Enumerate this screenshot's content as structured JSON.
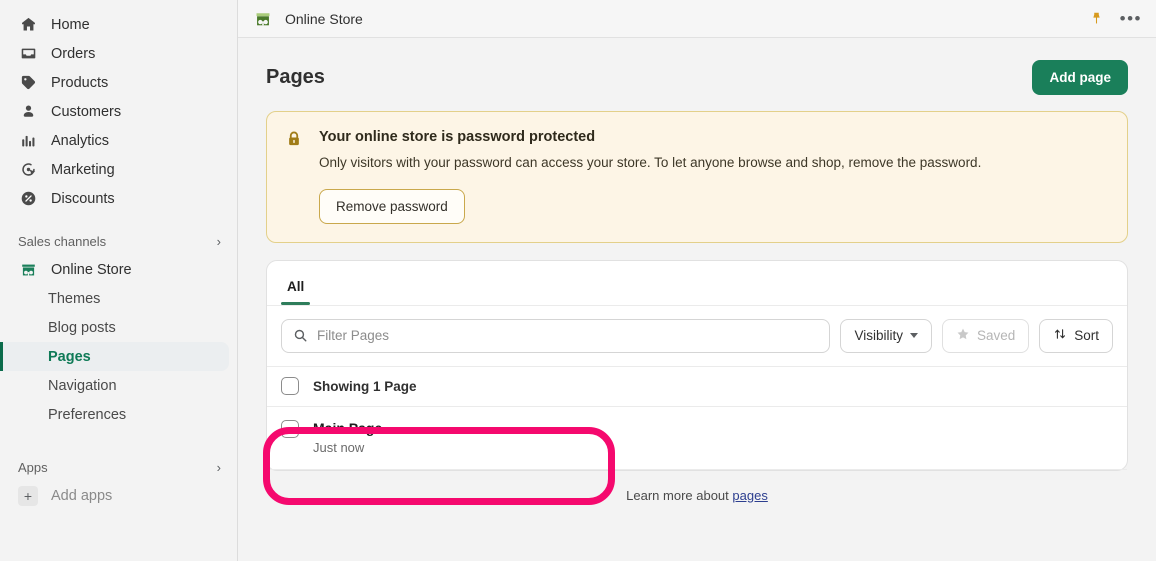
{
  "sidebar": {
    "primary_items": [
      {
        "label": "Home",
        "icon": "home-icon"
      },
      {
        "label": "Orders",
        "icon": "orders-icon"
      },
      {
        "label": "Products",
        "icon": "products-tag-icon"
      },
      {
        "label": "Customers",
        "icon": "customers-person-icon"
      },
      {
        "label": "Analytics",
        "icon": "analytics-bars-icon"
      },
      {
        "label": "Marketing",
        "icon": "marketing-target-icon"
      },
      {
        "label": "Discounts",
        "icon": "discounts-percent-icon"
      }
    ],
    "sales_channels": {
      "label": "Sales channels",
      "chevron": "chevron-right-icon"
    },
    "online_store": {
      "label": "Online Store",
      "icon": "storefront-icon"
    },
    "store_sub_items": [
      {
        "label": "Themes",
        "active": false
      },
      {
        "label": "Blog posts",
        "active": false
      },
      {
        "label": "Pages",
        "active": true
      },
      {
        "label": "Navigation",
        "active": false
      },
      {
        "label": "Preferences",
        "active": false
      }
    ],
    "apps": {
      "label": "Apps",
      "chevron": "chevron-right-icon"
    },
    "add_apps": {
      "label": "Add apps",
      "icon": "plus-icon"
    }
  },
  "topbar": {
    "title": "Online Store",
    "store_icon": "storefront-icon",
    "pin_icon": "pin-icon",
    "more_icon": "more-horizontal-icon",
    "more_label": "•••"
  },
  "page": {
    "title": "Pages",
    "add_button": "Add page"
  },
  "banner": {
    "icon": "lock-icon",
    "title": "Your online store is password protected",
    "body": "Only visitors with your password can access your store. To let anyone browse and shop, remove the password.",
    "button": "Remove password"
  },
  "card": {
    "tabs": [
      {
        "label": "All",
        "active": true
      }
    ],
    "toolbar": {
      "search_placeholder": "Filter Pages",
      "search_value": "",
      "search_icon": "search-icon",
      "visibility_label": "Visibility",
      "visibility_caret": "chevron-down-icon",
      "saved_label": "Saved",
      "saved_icon": "star-icon",
      "sort_label": "Sort",
      "sort_icon": "sort-arrows-icon"
    },
    "list_header": {
      "label": "Showing 1 Page",
      "checkbox": "select-all-checkbox"
    },
    "rows": [
      {
        "title": "Main Page",
        "subtitle": "Just now",
        "checkbox": "row-checkbox"
      }
    ]
  },
  "footer": {
    "text": "Learn more about",
    "link": "pages"
  },
  "annotation": {
    "color": "#f5096e",
    "target": "main-page-row"
  }
}
